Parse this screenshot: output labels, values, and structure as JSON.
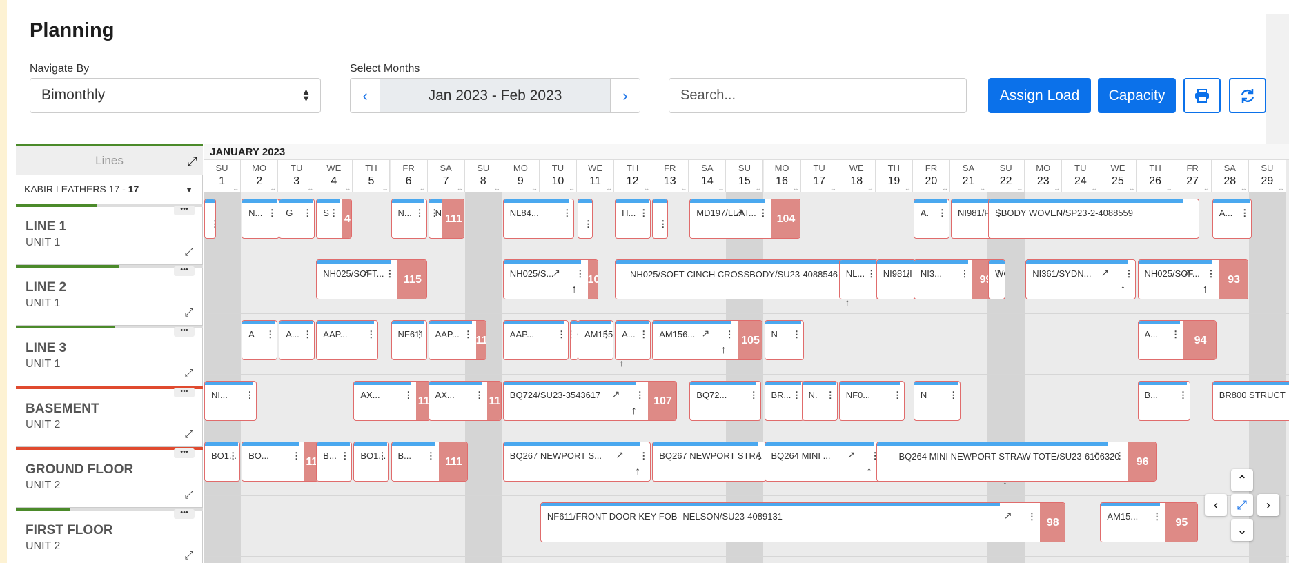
{
  "page": {
    "title": "Planning"
  },
  "filters": {
    "navigate_label": "Navigate By",
    "navigate_value": "Bimonthly",
    "months_label": "Select Months",
    "months_value": "Jan  2023 - Feb  2023",
    "search_placeholder": "Search..."
  },
  "toolbar": {
    "assign_label": "Assign Load",
    "capacity_label": "Capacity",
    "print_icon": "print-icon",
    "refresh_icon": "refresh-icon"
  },
  "accent_color": "#0b71ea",
  "lines_panel": {
    "header": "Lines",
    "factory_name": "KABIR LEATHERS 17 - ",
    "factory_count": "17"
  },
  "lines": [
    {
      "name": "LINE 1",
      "unit": "UNIT 1",
      "load": 0.43,
      "status_color": "#4b8a2a"
    },
    {
      "name": "LINE 2",
      "unit": "UNIT 1",
      "load": 0.55,
      "status_color": "#4b8a2a"
    },
    {
      "name": "LINE 3",
      "unit": "UNIT 1",
      "load": 0.53,
      "status_color": "#4b8a2a"
    },
    {
      "name": "BASEMENT",
      "unit": "UNIT 2",
      "load": 1.0,
      "status_color": "#e04a2f"
    },
    {
      "name": "GROUND FLOOR",
      "unit": "UNIT 2",
      "load": 1.0,
      "status_color": "#e04a2f"
    },
    {
      "name": "FIRST FLOOR",
      "unit": "UNIT 2",
      "load": 0.29,
      "status_color": "#4b8a2a"
    }
  ],
  "calendar": {
    "month": "JANUARY 2023",
    "days": [
      {
        "dn": "SU",
        "d": "1"
      },
      {
        "dn": "MO",
        "d": "2"
      },
      {
        "dn": "TU",
        "d": "3"
      },
      {
        "dn": "WE",
        "d": "4"
      },
      {
        "dn": "TH",
        "d": "5"
      },
      {
        "dn": "FR",
        "d": "6"
      },
      {
        "dn": "SA",
        "d": "7"
      },
      {
        "dn": "SU",
        "d": "8"
      },
      {
        "dn": "MO",
        "d": "9"
      },
      {
        "dn": "TU",
        "d": "10"
      },
      {
        "dn": "WE",
        "d": "11"
      },
      {
        "dn": "TH",
        "d": "12"
      },
      {
        "dn": "FR",
        "d": "13"
      },
      {
        "dn": "SA",
        "d": "14"
      },
      {
        "dn": "SU",
        "d": "15"
      },
      {
        "dn": "MO",
        "d": "16"
      },
      {
        "dn": "TU",
        "d": "17"
      },
      {
        "dn": "WE",
        "d": "18"
      },
      {
        "dn": "TH",
        "d": "19"
      },
      {
        "dn": "FR",
        "d": "20"
      },
      {
        "dn": "SA",
        "d": "21"
      },
      {
        "dn": "SU",
        "d": "22"
      },
      {
        "dn": "MO",
        "d": "23"
      },
      {
        "dn": "TU",
        "d": "24"
      },
      {
        "dn": "WE",
        "d": "25"
      },
      {
        "dn": "TH",
        "d": "26"
      },
      {
        "dn": "FR",
        "d": "27"
      },
      {
        "dn": "SA",
        "d": "28"
      },
      {
        "dn": "SU",
        "d": "29"
      }
    ]
  },
  "blocks": [
    {
      "row": 0,
      "d": 0,
      "span": 0.35,
      "label": "",
      "km": true
    },
    {
      "row": 0,
      "d": 1,
      "span": 1.05,
      "label": "N..."
    },
    {
      "row": 0,
      "d": 2,
      "span": 1.0,
      "label": "G"
    },
    {
      "row": 0,
      "d": 3,
      "span": 1.0,
      "label": "S",
      "badge": "4",
      "bw": 0.3
    },
    {
      "row": 0,
      "d": 5,
      "span": 1.0,
      "label": "N..."
    },
    {
      "row": 0,
      "d": 6,
      "span": 1.0,
      "label": "N...",
      "badge": "111",
      "bw": 0.6
    },
    {
      "row": 0,
      "d": 8,
      "span": 1.95,
      "label": "NL84..."
    },
    {
      "row": 0,
      "d": 10,
      "span": 0.45,
      "label": "",
      "km": true
    },
    {
      "row": 0,
      "d": 11,
      "span": 1.0,
      "label": "H..."
    },
    {
      "row": 0,
      "d": 12,
      "span": 0.45,
      "label": "",
      "km": true
    },
    {
      "row": 0,
      "d": 13,
      "span": 3.0,
      "label": "MD197/LEAT...",
      "trend": true,
      "badge": "104",
      "bw": 0.8
    },
    {
      "row": 0,
      "d": 19,
      "span": 1.0,
      "label": "A."
    },
    {
      "row": 0,
      "d": 20,
      "span": 2.4,
      "label": "NI981/PUFFY CR"
    },
    {
      "row": 0,
      "d": 21,
      "span": 5.7,
      "label": "SBODY WOVEN/SP23-2-4088559",
      "km": true
    },
    {
      "row": 0,
      "d": 27,
      "span": 1.1,
      "label": "A..."
    },
    {
      "row": 1,
      "d": 3,
      "span": 3.0,
      "label": "NH025/SOFT...",
      "trend": true,
      "badge": "115",
      "bw": 0.8
    },
    {
      "row": 1,
      "d": 8,
      "span": 2.6,
      "label": "NH025/S...",
      "trend": true,
      "up": true,
      "badge": "10",
      "bw": 0.3
    },
    {
      "row": 1,
      "d": 11,
      "span": 6.8,
      "label": "NH025/SOFT CINCH CROSSBODY/SU23-4088546",
      "wrap": true
    },
    {
      "row": 1,
      "d": 17,
      "span": 1.1,
      "label": "NL...",
      "upbelow": true
    },
    {
      "row": 1,
      "d": 18,
      "span": 1.1,
      "label": "NI981/I"
    },
    {
      "row": 1,
      "d": 19,
      "span": 2.3,
      "label": "NI3...",
      "badge": "99",
      "bw": 0.7
    },
    {
      "row": 1,
      "d": 21,
      "span": 0.5,
      "label": "WO"
    },
    {
      "row": 1,
      "d": 22,
      "span": 3.0,
      "label": "NI361/SYDN...",
      "trend": true,
      "up": true
    },
    {
      "row": 1,
      "d": 25,
      "span": 3.0,
      "label": "NH025/SOF...",
      "trend": true,
      "up": true,
      "badge": "93",
      "bw": 0.8
    },
    {
      "row": 2,
      "d": 1,
      "span": 1.0,
      "label": "A"
    },
    {
      "row": 2,
      "d": 2,
      "span": 1.0,
      "label": "A..."
    },
    {
      "row": 2,
      "d": 3,
      "span": 1.7,
      "label": "AAP..."
    },
    {
      "row": 2,
      "d": 5,
      "span": 1.0,
      "label": "NF611"
    },
    {
      "row": 2,
      "d": 6,
      "span": 1.6,
      "label": "AAP...",
      "badge": "11",
      "bw": 0.3
    },
    {
      "row": 2,
      "d": 8,
      "span": 1.8,
      "label": "AAP..."
    },
    {
      "row": 2,
      "d": 9.8,
      "span": 0.25,
      "label": "O"
    },
    {
      "row": 2,
      "d": 10,
      "span": 1.0,
      "label": "AM155"
    },
    {
      "row": 2,
      "d": 11,
      "span": 1.0,
      "label": "A...",
      "upbelow": true
    },
    {
      "row": 2,
      "d": 12,
      "span": 3.0,
      "label": "AM156...",
      "trend": true,
      "up": true,
      "badge": "105",
      "bw": 0.7
    },
    {
      "row": 2,
      "d": 15,
      "span": 1.1,
      "label": "N"
    },
    {
      "row": 2,
      "d": 25,
      "span": 2.15,
      "label": "A...",
      "badge": "94",
      "bw": 0.9
    },
    {
      "row": 3,
      "d": 0,
      "span": 1.45,
      "label": "NI..."
    },
    {
      "row": 3,
      "d": 4,
      "span": 2.1,
      "label": "AX...",
      "badge": "11",
      "bw": 0.4
    },
    {
      "row": 3,
      "d": 6,
      "span": 2.0,
      "label": "AX...",
      "badge": "11",
      "bw": 0.4
    },
    {
      "row": 3,
      "d": 8,
      "span": 4.7,
      "label": "BQ724/SU23-3543617",
      "trend": true,
      "up": true,
      "badge": "107",
      "bw": 0.8
    },
    {
      "row": 3,
      "d": 13,
      "span": 1.95,
      "label": "BQ72..."
    },
    {
      "row": 3,
      "d": 15,
      "span": 1.1,
      "label": "BR..."
    },
    {
      "row": 3,
      "d": 16,
      "span": 1.0,
      "label": "N."
    },
    {
      "row": 3,
      "d": 17,
      "span": 1.8,
      "label": "NF0..."
    },
    {
      "row": 3,
      "d": 19,
      "span": 1.3,
      "label": "N"
    },
    {
      "row": 3,
      "d": 25,
      "span": 1.45,
      "label": "B..."
    },
    {
      "row": 3,
      "d": 27,
      "span": 2.6,
      "label": "BR800 STRUCT"
    },
    {
      "row": 4,
      "d": 0,
      "span": 1.0,
      "label": "BO1..."
    },
    {
      "row": 4,
      "d": 1,
      "span": 2.1,
      "label": "BO...",
      "badge": "11",
      "bw": 0.4
    },
    {
      "row": 4,
      "d": 3,
      "span": 1.0,
      "label": "B..."
    },
    {
      "row": 4,
      "d": 4,
      "span": 1.0,
      "label": "BO1..."
    },
    {
      "row": 4,
      "d": 5,
      "span": 2.1,
      "label": "B...",
      "badge": "111",
      "bw": 0.8
    },
    {
      "row": 4,
      "d": 8,
      "span": 4.0,
      "label": "BQ267 NEWPORT S...",
      "trend": true,
      "up": true
    },
    {
      "row": 4,
      "d": 12,
      "span": 3.1,
      "label": "BQ267 NEWPORT STRA"
    },
    {
      "row": 4,
      "d": 15,
      "span": 3.2,
      "label": "BQ264 MINI ...",
      "trend": true,
      "up": true
    },
    {
      "row": 4,
      "d": 18,
      "span": 7.55,
      "label": "BQ264 MINI NEWPORT STRAW TOTE/SU23-6106320",
      "wrap": true,
      "trend": true,
      "upbelow": true,
      "badge": "96",
      "bw": 0.8
    },
    {
      "row": 5,
      "d": 9,
      "span": 14.1,
      "label": "NF611/FRONT DOOR KEY FOB- NELSON/SU23-4089131",
      "trend": true,
      "badge": "98",
      "bw": 0.7
    },
    {
      "row": 5,
      "d": 24,
      "span": 2.65,
      "label": "AM15...",
      "badge": "95",
      "bw": 0.9
    }
  ]
}
